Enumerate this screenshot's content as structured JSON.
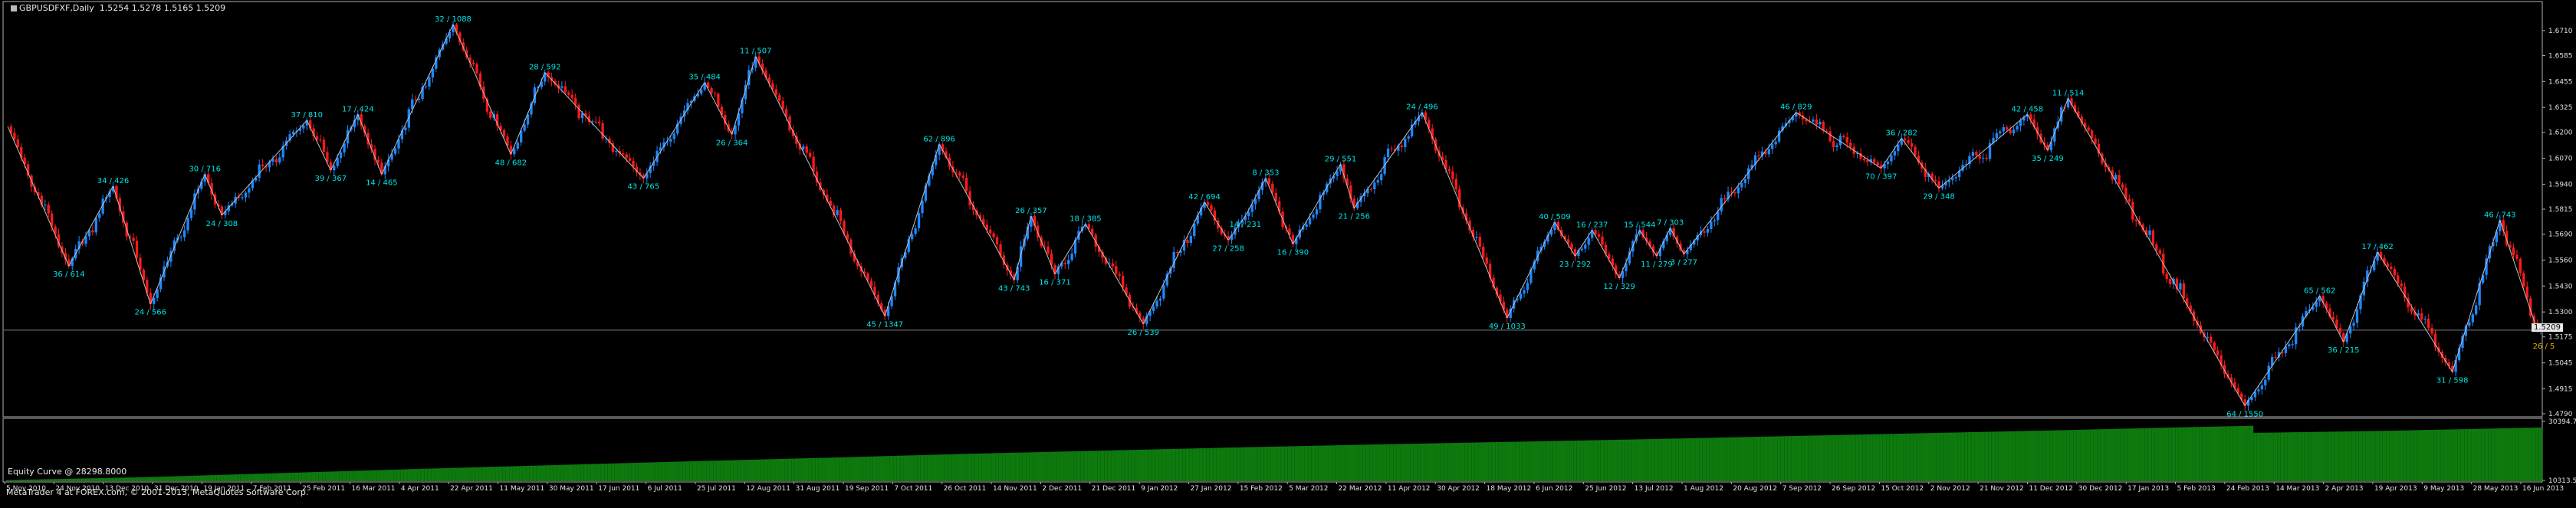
{
  "header": {
    "title": "GBPUSDFXF,Daily",
    "ohlc": "1.5254 1.5278 1.5165 1.5209"
  },
  "equity": {
    "label": "Equity Curve @ 28298.8000",
    "max_label": "30394.76",
    "min_label": "10313.51"
  },
  "footer": {
    "copyright": "MetaTrader 4 at FOREX.com, © 2001-2013, MetaQuotes Software Corp."
  },
  "colors": {
    "up": "#1e88ff",
    "down": "#ff1a1a",
    "label": "#00e5e5",
    "current_label": "#e0b000",
    "zigzag": "#bfbfbf",
    "equity": "#0e7a0e",
    "frame": "#b0b0b0"
  },
  "chart_data": [
    {
      "type": "candlestick",
      "title": "GBPUSDFXF,Daily",
      "ylim": [
        1.479,
        1.684
      ],
      "y_ticks": [
        "1.6710",
        "1.6585",
        "1.6455",
        "1.6325",
        "1.6200",
        "1.6070",
        "1.5940",
        "1.5815",
        "1.5690",
        "1.5560",
        "1.5430",
        "1.5300",
        "1.5175",
        "1.5045",
        "1.4915",
        "1.4790"
      ],
      "last_price": "1.5209",
      "x_tick_labels": [
        "5 Nov 2010",
        "24 Nov 2010",
        "13 Dec 2010",
        "31 Dec 2010",
        "19 Jan 2011",
        "7 Feb 2011",
        "25 Feb 2011",
        "16 Mar 2011",
        "4 Apr 2011",
        "22 Apr 2011",
        "11 May 2011",
        "30 May 2011",
        "17 Jun 2011",
        "6 Jul 2011",
        "25 Jul 2011",
        "12 Aug 2011",
        "31 Aug 2011",
        "19 Sep 2011",
        "7 Oct 2011",
        "26 Oct 2011",
        "14 Nov 2011",
        "2 Dec 2011",
        "21 Dec 2011",
        "9 Jan 2012",
        "27 Jan 2012",
        "15 Feb 2012",
        "5 Mar 2012",
        "22 Mar 2012",
        "11 Apr 2012",
        "30 Apr 2012",
        "18 May 2012",
        "6 Jun 2012",
        "25 Jun 2012",
        "13 Jul 2012",
        "1 Aug 2012",
        "20 Aug 2012",
        "7 Sep 2012",
        "26 Sep 2012",
        "15 Oct 2012",
        "2 Nov 2012",
        "21 Nov 2012",
        "11 Dec 2012",
        "30 Dec 2012",
        "17 Jan 2013",
        "5 Feb 2013",
        "24 Feb 2013",
        "14 Mar 2013",
        "2 Apr 2013",
        "19 Apr 2013",
        "9 May 2013",
        "28 May 2013",
        "16 Jun 2013"
      ],
      "zigzag": [
        {
          "i": 0,
          "price": 1.623,
          "label": "",
          "pos": "top"
        },
        {
          "i": 18,
          "price": 1.553,
          "label": "36 / 614",
          "pos": "below"
        },
        {
          "i": 31,
          "price": 1.593,
          "label": "34 / 426",
          "pos": "above"
        },
        {
          "i": 42,
          "price": 1.534,
          "label": "24 / 566",
          "pos": "below"
        },
        {
          "i": 58,
          "price": 1.599,
          "label": "30 / 716",
          "pos": "above"
        },
        {
          "i": 63,
          "price": 1.5785,
          "label": "24 / 308",
          "pos": "below"
        },
        {
          "i": 88,
          "price": 1.626,
          "label": "37 / 810",
          "pos": "above"
        },
        {
          "i": 95,
          "price": 1.601,
          "label": "39 / 367",
          "pos": "below"
        },
        {
          "i": 103,
          "price": 1.629,
          "label": "17 / 424",
          "pos": "above"
        },
        {
          "i": 110,
          "price": 1.599,
          "label": "14 / 465",
          "pos": "below"
        },
        {
          "i": 131,
          "price": 1.674,
          "label": "32 / 1088",
          "pos": "above"
        },
        {
          "i": 148,
          "price": 1.609,
          "label": "48 / 682",
          "pos": "below"
        },
        {
          "i": 158,
          "price": 1.65,
          "label": "28 / 592",
          "pos": "above"
        },
        {
          "i": 187,
          "price": 1.597,
          "label": "43 / 765",
          "pos": "below"
        },
        {
          "i": 205,
          "price": 1.645,
          "label": "35 / 484",
          "pos": "above"
        },
        {
          "i": 213,
          "price": 1.619,
          "label": "26 / 364",
          "pos": "below"
        },
        {
          "i": 220,
          "price": 1.658,
          "label": "11 / 507",
          "pos": "above"
        },
        {
          "i": 258,
          "price": 1.528,
          "label": "45 / 1347",
          "pos": "below"
        },
        {
          "i": 274,
          "price": 1.614,
          "label": "62 / 896",
          "pos": "above"
        },
        {
          "i": 296,
          "price": 1.546,
          "label": "43 / 743",
          "pos": "below"
        },
        {
          "i": 301,
          "price": 1.578,
          "label": "26 / 357",
          "pos": "above"
        },
        {
          "i": 308,
          "price": 1.549,
          "label": "16 / 371",
          "pos": "below"
        },
        {
          "i": 317,
          "price": 1.574,
          "label": "18 / 385",
          "pos": "above"
        },
        {
          "i": 334,
          "price": 1.524,
          "label": "26 / 539",
          "pos": "below"
        },
        {
          "i": 352,
          "price": 1.585,
          "label": "42 / 694",
          "pos": "above"
        },
        {
          "i": 359,
          "price": 1.566,
          "label": "27 / 258",
          "pos": "below"
        },
        {
          "i": 364,
          "price": 1.578,
          "label": "14 / 231",
          "pos": "below"
        },
        {
          "i": 370,
          "price": 1.597,
          "label": "8 / 353",
          "pos": "above"
        },
        {
          "i": 378,
          "price": 1.564,
          "label": "16 / 390",
          "pos": "below"
        },
        {
          "i": 392,
          "price": 1.604,
          "label": "29 / 551",
          "pos": "above"
        },
        {
          "i": 396,
          "price": 1.582,
          "label": "21 / 256",
          "pos": "below"
        },
        {
          "i": 416,
          "price": 1.63,
          "label": "24 / 496",
          "pos": "above"
        },
        {
          "i": 441,
          "price": 1.527,
          "label": "49 / 1033",
          "pos": "below"
        },
        {
          "i": 455,
          "price": 1.575,
          "label": "40 / 509",
          "pos": "above"
        },
        {
          "i": 461,
          "price": 1.558,
          "label": "23 / 292",
          "pos": "below"
        },
        {
          "i": 466,
          "price": 1.571,
          "label": "16 / 237",
          "pos": "above"
        },
        {
          "i": 474,
          "price": 1.547,
          "label": "12 / 329",
          "pos": "below"
        },
        {
          "i": 480,
          "price": 1.571,
          "label": "15 / 544",
          "pos": "above"
        },
        {
          "i": 485,
          "price": 1.558,
          "label": "11 / 279",
          "pos": "below"
        },
        {
          "i": 489,
          "price": 1.572,
          "label": "7 / 303",
          "pos": "above"
        },
        {
          "i": 493,
          "price": 1.559,
          "label": "3 / 277",
          "pos": "below"
        },
        {
          "i": 526,
          "price": 1.63,
          "label": "46 / 829",
          "pos": "above"
        },
        {
          "i": 551,
          "price": 1.602,
          "label": "70 / 397",
          "pos": "below"
        },
        {
          "i": 557,
          "price": 1.617,
          "label": "36 / 282",
          "pos": "above"
        },
        {
          "i": 568,
          "price": 1.592,
          "label": "29 / 348",
          "pos": "below"
        },
        {
          "i": 594,
          "price": 1.629,
          "label": "42 / 458",
          "pos": "above"
        },
        {
          "i": 600,
          "price": 1.611,
          "label": "35 / 249",
          "pos": "below"
        },
        {
          "i": 606,
          "price": 1.637,
          "label": "11 / 514",
          "pos": "above"
        },
        {
          "i": 658,
          "price": 1.483,
          "label": "64 / 1550",
          "pos": "below"
        },
        {
          "i": 680,
          "price": 1.538,
          "label": "65 / 562",
          "pos": "above"
        },
        {
          "i": 687,
          "price": 1.515,
          "label": "36 / 215",
          "pos": "below"
        },
        {
          "i": 697,
          "price": 1.56,
          "label": "17 / 462",
          "pos": "above"
        },
        {
          "i": 719,
          "price": 1.5,
          "label": "31 / 598",
          "pos": "below"
        },
        {
          "i": 733,
          "price": 1.576,
          "label": "46 / 743",
          "pos": "above"
        },
        {
          "i": 744,
          "price": 1.5209,
          "label": "26 / 5",
          "pos": "current"
        }
      ]
    },
    {
      "type": "bar",
      "title": "Equity Curve @ 28298.8000",
      "ylim": [
        10313.51,
        30394.76
      ],
      "x": [
        0,
        40,
        80,
        120,
        160,
        200,
        240,
        280,
        320,
        360,
        400,
        440,
        480,
        520,
        560,
        600,
        640,
        660,
        661,
        700,
        744
      ],
      "values": [
        10450,
        11400,
        12800,
        14200,
        15500,
        16800,
        18000,
        19300,
        20400,
        21500,
        22500,
        23400,
        24300,
        25300,
        26300,
        27300,
        28400,
        28900,
        26500,
        27200,
        28300
      ]
    }
  ]
}
